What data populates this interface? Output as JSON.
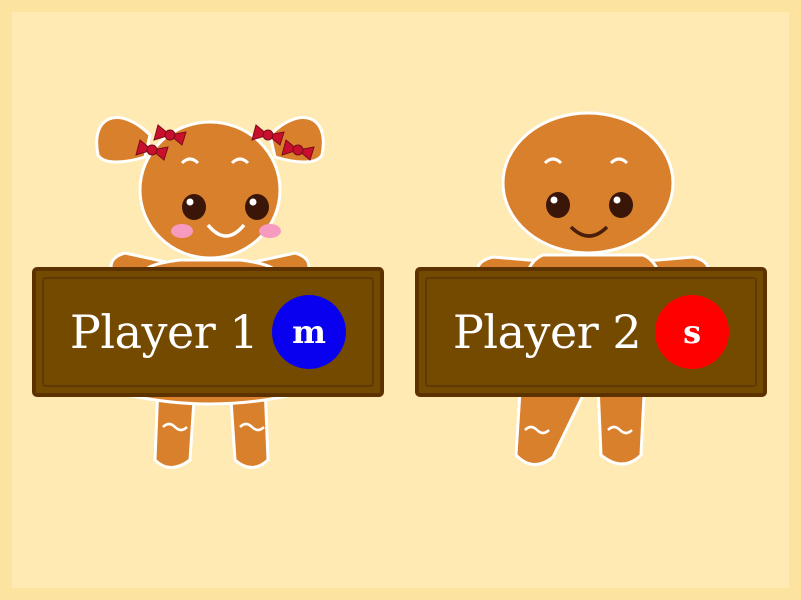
{
  "players": [
    {
      "label": "Player 1",
      "key": "m",
      "key_color": "#0a00f0",
      "character": "gingerbread-girl"
    },
    {
      "label": "Player 2",
      "key": "s",
      "key_color": "#ff0000",
      "character": "gingerbread-boy"
    }
  ],
  "colors": {
    "background": "#feeab2",
    "border": "#fde3a0",
    "cookie": "#d9802c",
    "icing": "#ffffff",
    "sign": "#744a00",
    "bow": "#c8102e"
  }
}
